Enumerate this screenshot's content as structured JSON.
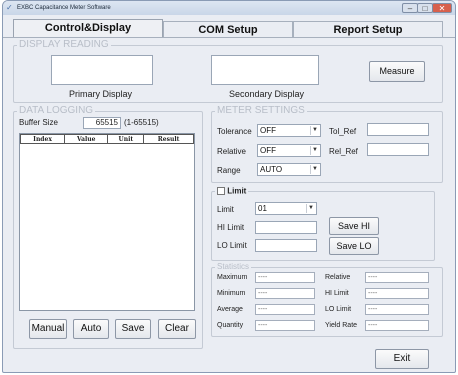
{
  "window": {
    "title": "EXBC Capacitance Meter Software"
  },
  "tabs": [
    "Control&Display",
    "COM Setup",
    "Report Setup"
  ],
  "display_reading": {
    "legend": "DISPLAY READING",
    "primary_label": "Primary Display",
    "secondary_label": "Secondary Display",
    "measure_button": "Measure"
  },
  "data_logging": {
    "legend": "DATA LOGGING",
    "buffer_label": "Buffer Size",
    "buffer_value": "65515",
    "buffer_range": "(1-65515)",
    "columns": [
      "Index",
      "Value",
      "Unit",
      "Result"
    ],
    "buttons": {
      "manual": "Manual",
      "auto": "Auto",
      "save": "Save",
      "clear": "Clear"
    }
  },
  "meter_settings": {
    "legend": "METER SETTINGS",
    "tolerance_label": "Tolerance",
    "tolerance_value": "OFF",
    "relative_label": "Relative",
    "relative_value": "OFF",
    "range_label": "Range",
    "range_value": "AUTO",
    "tol_ref_label": "Tol_Ref",
    "rel_ref_label": "Rel_Ref"
  },
  "limit": {
    "legend": "Limit",
    "limit_label": "Limit",
    "limit_value": "01",
    "hi_label": "HI Limit",
    "lo_label": "LO Limit",
    "save_hi": "Save HI",
    "save_lo": "Save LO"
  },
  "statistics": {
    "legend": "Statistics",
    "maximum_label": "Maximum",
    "minimum_label": "Minimum",
    "average_label": "Average",
    "quantity_label": "Quantity",
    "relative_label": "Relative",
    "hi_limit_label": "HI Limit",
    "lo_limit_label": "LO Limit",
    "yield_rate_label": "Yield Rate",
    "empty_value": "----"
  },
  "footer": {
    "exit_button": "Exit"
  }
}
